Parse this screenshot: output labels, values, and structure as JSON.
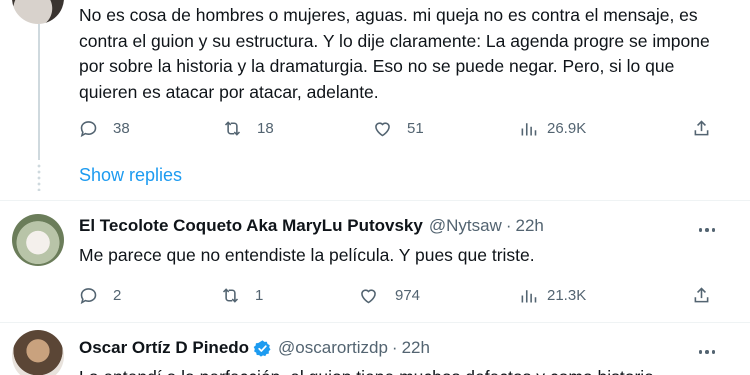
{
  "tweets": [
    {
      "text": "No es cosa de hombres o mujeres, aguas. mi queja no es contra el mensaje, es contra el guion y su estructura. Y lo dije claramente: La agenda progre se impone por sobre la historia y la dramaturgia. Eso no se puede negar. Pero, si lo que quieren es atacar por atacar, adelante.",
      "replies": "38",
      "retweets": "18",
      "likes": "51",
      "views": "26.9K"
    },
    {
      "name": "El Tecolote Coqueto Aka MaryLu Putovsky",
      "handle": "@Nytsaw",
      "time": "22h",
      "text": "Me parece que no entendiste la película. Y pues que triste.",
      "replies": "2",
      "retweets": "1",
      "likes": "974",
      "views": "21.3K"
    },
    {
      "name": "Oscar Ortíz D Pinedo",
      "handle": "@oscarortizdp",
      "time": "22h",
      "text": "Lo entendí a la perfección, el guion tiene muchos defectos y como historia"
    }
  ],
  "show_replies": "Show replies",
  "separator": "·",
  "colors": {
    "accent": "#1d9bf0",
    "muted": "#536471",
    "text": "#0f1419"
  },
  "icons": [
    "reply-icon",
    "retweet-icon",
    "like-icon",
    "views-icon",
    "share-icon",
    "more-icon",
    "verified-icon"
  ]
}
